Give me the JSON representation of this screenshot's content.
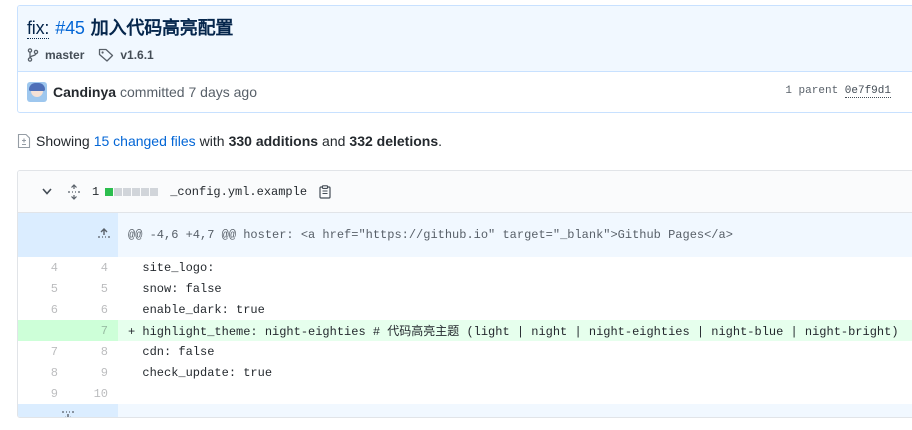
{
  "commit": {
    "prefix": "fix:",
    "issue": "#45",
    "message": "加入代码高亮配置",
    "branch": "master",
    "tag": "v1.6.1",
    "author": "Candinya",
    "committed_text": "committed 7 days ago",
    "parent_label": "1 parent",
    "parent_sha": "0e7f9d1"
  },
  "summary": {
    "showing": "Showing",
    "changed_files": "15 changed files",
    "with": "with",
    "additions": "330 additions",
    "and": "and",
    "deletions": "332 deletions",
    "period": "."
  },
  "file": {
    "change_count": "1",
    "name": "_config.yml.example",
    "diffstat": [
      "add",
      "neutral",
      "neutral",
      "neutral",
      "neutral",
      "neutral"
    ],
    "hunk_header": "@@ -4,6 +4,7 @@ hoster: <a href=\"https://github.io\" target=\"_blank\">Github Pages</a>",
    "lines": [
      {
        "type": "context",
        "old": "4",
        "new": "4",
        "text": "  site_logo:"
      },
      {
        "type": "context",
        "old": "5",
        "new": "5",
        "text": "  snow: false"
      },
      {
        "type": "context",
        "old": "6",
        "new": "6",
        "text": "  enable_dark: true"
      },
      {
        "type": "addition",
        "old": "",
        "new": "7",
        "text": "+ highlight_theme: night-eighties # 代码高亮主题 (light | night | night-eighties | night-blue | night-bright)"
      },
      {
        "type": "context",
        "old": "7",
        "new": "8",
        "text": "  cdn: false"
      },
      {
        "type": "context",
        "old": "8",
        "new": "9",
        "text": "  check_update: true"
      },
      {
        "type": "context",
        "old": "9",
        "new": "10",
        "text": ""
      }
    ]
  },
  "colors": {
    "accent": "#0366d6",
    "addition_bg": "#e6ffed",
    "addition_num_bg": "#cdffd8",
    "hunk_bg": "#f1f8ff"
  }
}
